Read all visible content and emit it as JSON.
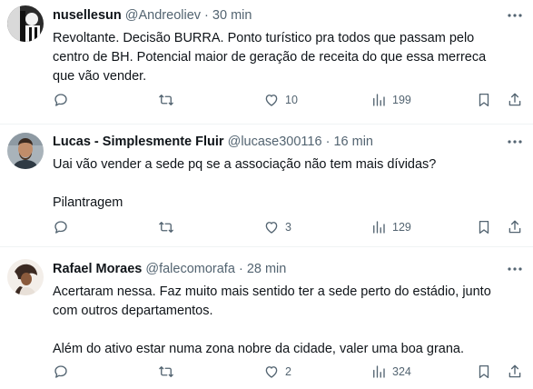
{
  "tweets": [
    {
      "name": "nusellesun",
      "handle": "@Andreoliev",
      "separator": "·",
      "time": "30 min",
      "lines": [
        "Revoltante. Decisão BURRA. Ponto turístico pra todos que passam pelo",
        "centro de BH. Potencial maior de geração de receita do que essa merreca",
        "que vão vender."
      ],
      "likes": "10",
      "views": "199"
    },
    {
      "name": "Lucas - Simplesmente Fluir",
      "handle": "@lucase300116",
      "separator": "·",
      "time": "16 min",
      "lines": [
        "Uai vão vender a sede pq se a associação não tem mais dívidas?"
      ],
      "extra": "Pilantragem",
      "likes": "3",
      "views": "129"
    },
    {
      "name": "Rafael Moraes",
      "handle": "@falecomorafa",
      "separator": "·",
      "time": "28 min",
      "lines": [
        "Acertaram nessa. Faz muito mais sentido ter a sede perto do estádio, junto",
        "com outros departamentos."
      ],
      "extra": "Além do ativo estar numa zona nobre da cidade, valer uma boa grana.",
      "likes": "2",
      "views": "324"
    }
  ],
  "icons": {
    "reply": "reply-icon",
    "retweet": "retweet-icon",
    "like": "like-icon",
    "views": "views-icon",
    "bookmark": "bookmark-icon",
    "share": "share-icon",
    "more": "more-icon"
  },
  "colors": {
    "text": "#0f1419",
    "secondary": "#536471",
    "divider": "#eff3f4"
  }
}
